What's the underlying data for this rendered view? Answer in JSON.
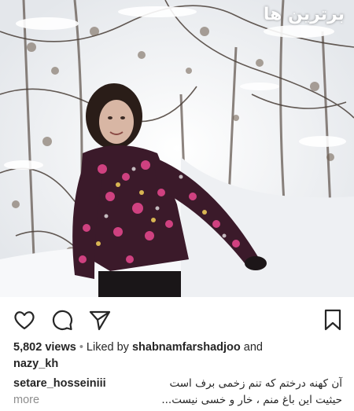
{
  "watermark": "برترین ها",
  "actions": {
    "like_icon": "heart-outline-icon",
    "comment_icon": "comment-bubble-icon",
    "share_icon": "paper-plane-icon",
    "save_icon": "bookmark-icon"
  },
  "meta": {
    "views": "5,802 views",
    "separator": "•",
    "liked_by_prefix": "Liked by",
    "liked_by_user": "shabnamfarshadjoo",
    "and": "and",
    "second_user": "nazy_kh"
  },
  "caption": {
    "username": "setare_hosseiniii",
    "line1": "آن کهنه درختم که تنم زخمی برف است",
    "line2": "حیثیت این باغ منم ، خار و خسی نیست...",
    "more": "more"
  },
  "colors": {
    "text": "#262626",
    "muted": "#8e8e8e",
    "jacket": "#3b1a2a",
    "jacket_print": "#e0468a"
  }
}
